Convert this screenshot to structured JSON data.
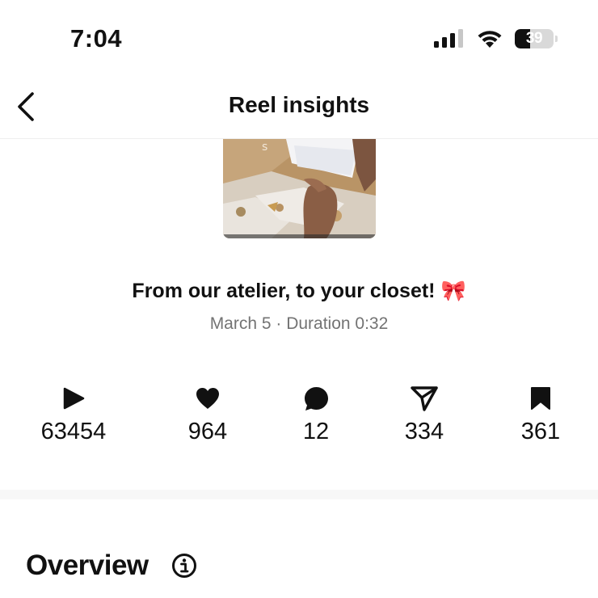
{
  "status_bar": {
    "time": "7:04",
    "battery_percent": "39",
    "battery_level": 0.39
  },
  "nav": {
    "title": "Reel insights"
  },
  "reel": {
    "title": "From our atelier, to your closet! 🎀",
    "meta": "March 5 · Duration 0:32"
  },
  "metrics": [
    {
      "icon": "play-icon",
      "value": "63454"
    },
    {
      "icon": "heart-icon",
      "value": "964"
    },
    {
      "icon": "comment-icon",
      "value": "12"
    },
    {
      "icon": "share-icon",
      "value": "334"
    },
    {
      "icon": "bookmark-icon",
      "value": "361"
    }
  ],
  "overview": {
    "title": "Overview"
  }
}
